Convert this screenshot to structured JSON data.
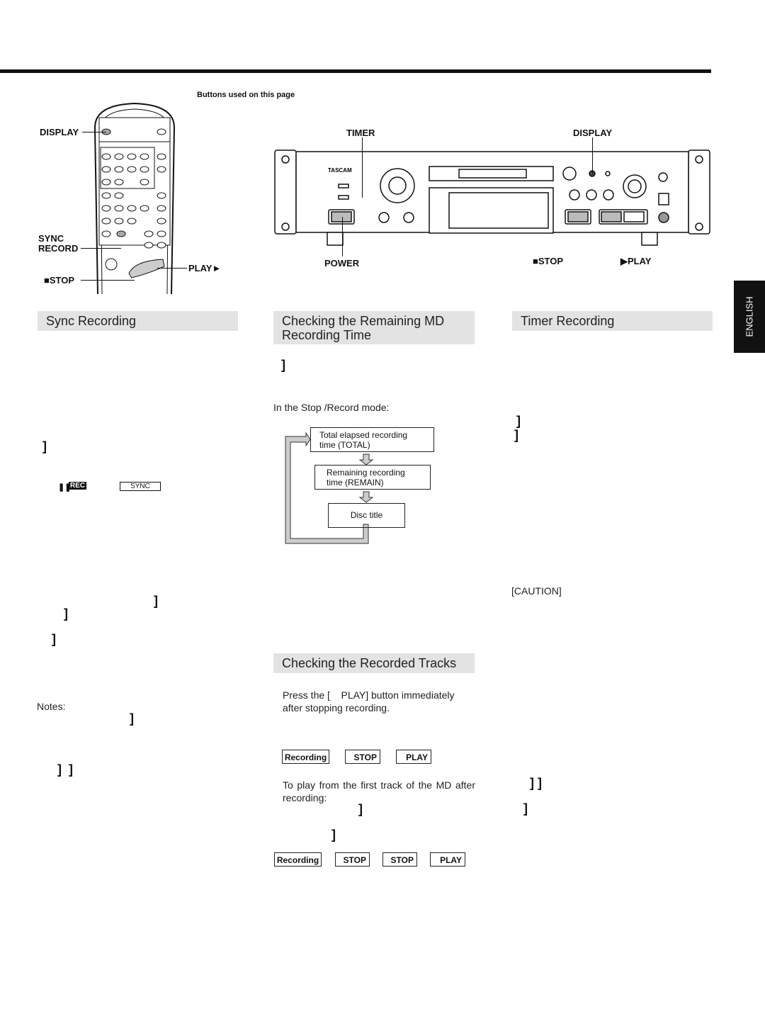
{
  "header": {
    "buttons_used": "Buttons used on this page"
  },
  "remote": {
    "display": "DISPLAY",
    "sync_record": [
      "SYNC",
      "RECORD"
    ],
    "play": "PLAY►",
    "stop": "■STOP"
  },
  "deck": {
    "timer": "TIMER",
    "display": "DISPLAY",
    "power": "POWER",
    "stop": "■STOP",
    "play": "▶PLAY",
    "brand": "TASCAM"
  },
  "language_tab": "ENGLISH",
  "sync_recording": {
    "title": "Sync Recording",
    "indicator_pause": "❚❚",
    "indicator_rec": "REC",
    "indicator_sync": "SYNC",
    "notes": "Notes:"
  },
  "remaining": {
    "title_line1": "Checking the Remaining MD",
    "title_line2": "Recording Time",
    "mode_text": "In the Stop /Record mode:",
    "flow": [
      "Total elapsed recording time (TOTAL)",
      "Remaining recording time (REMAIN)",
      "Disc title"
    ]
  },
  "recorded": {
    "title": "Checking the Recorded Tracks",
    "press_text": "Press the [    PLAY] button immediately after stopping recording.",
    "sequence1": [
      "Recording",
      "STOP",
      "PLAY"
    ],
    "first_track_text": "To play from the first track of the MD after recording:",
    "sequence2": [
      "Recording",
      "STOP",
      "STOP",
      "PLAY"
    ]
  },
  "timer": {
    "title": "Timer Recording",
    "caution": "[CAUTION]"
  },
  "fragments": {
    "bracket": "]",
    "double_bracket": "]  ]",
    "double_bracket2": "] ]"
  }
}
